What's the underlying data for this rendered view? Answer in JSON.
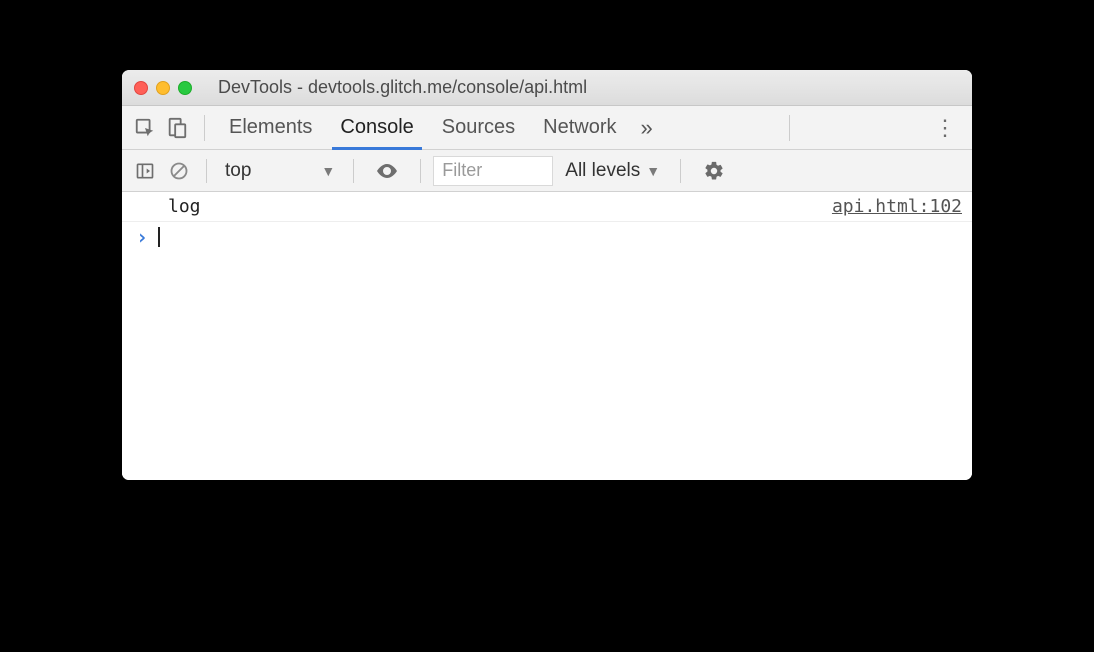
{
  "window": {
    "title": "DevTools - devtools.glitch.me/console/api.html"
  },
  "tabs": {
    "items": [
      "Elements",
      "Console",
      "Sources",
      "Network"
    ],
    "active_index": 1,
    "overflow_glyph": "»"
  },
  "console_toolbar": {
    "context": "top",
    "filter_placeholder": "Filter",
    "levels_label": "All levels"
  },
  "console": {
    "entries": [
      {
        "text": "log",
        "source": "api.html:102"
      }
    ],
    "prompt_glyph": "›"
  }
}
